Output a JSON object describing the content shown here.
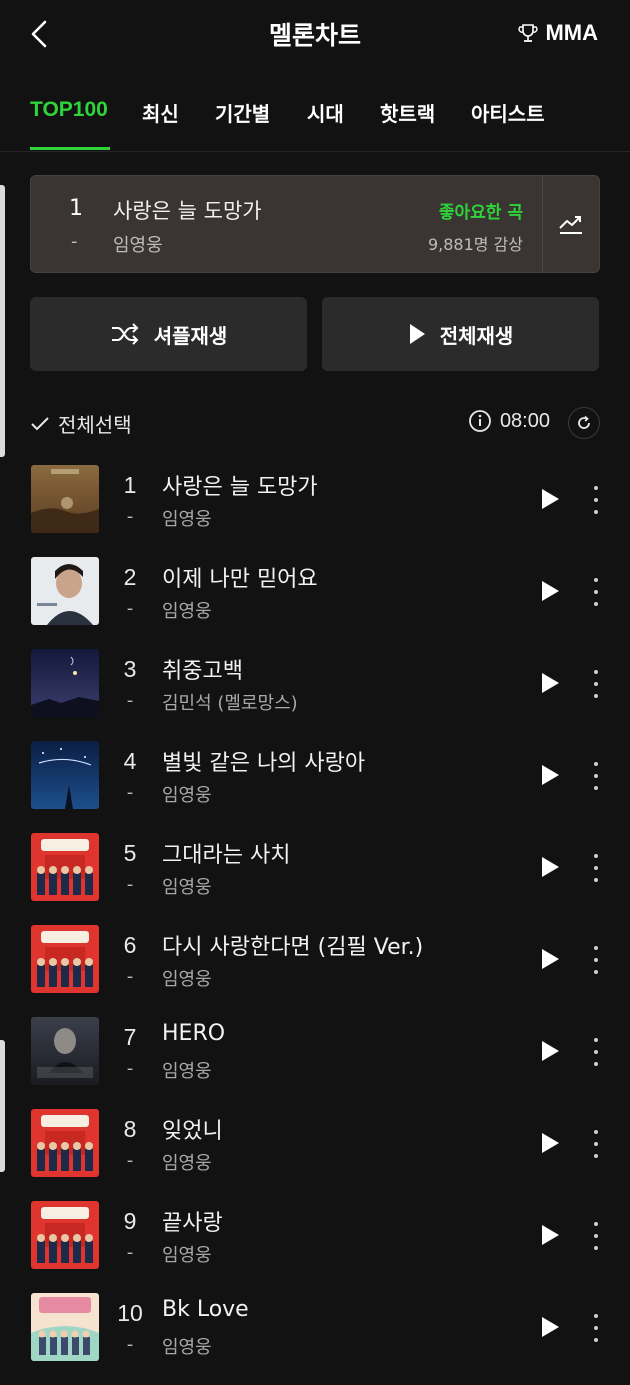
{
  "header": {
    "title": "멜론차트",
    "mma_label": "MMA"
  },
  "tabs": [
    {
      "label": "TOP100",
      "active": true
    },
    {
      "label": "최신"
    },
    {
      "label": "기간별"
    },
    {
      "label": "시대"
    },
    {
      "label": "핫트랙"
    },
    {
      "label": "아티스트"
    }
  ],
  "now_card": {
    "rank": "1",
    "change": "-",
    "title": "사랑은 늘 도망가",
    "artist": "임영웅",
    "like_label": "좋아요한 곡",
    "listeners": "9,881명 감상"
  },
  "actions": {
    "shuffle_label": "셔플재생",
    "play_all_label": "전체재생"
  },
  "list_header": {
    "select_all_label": "전체선택",
    "time": "08:00"
  },
  "colors": {
    "accent": "#2fd33a",
    "background": "#121212",
    "card": "#3a3533",
    "button": "#2b2b2b"
  },
  "songs": [
    {
      "rank": "1",
      "change": "-",
      "title": "사랑은 늘 도망가",
      "artist": "임영웅"
    },
    {
      "rank": "2",
      "change": "-",
      "title": "이제 나만 믿어요",
      "artist": "임영웅"
    },
    {
      "rank": "3",
      "change": "-",
      "title": "취중고백",
      "artist": "김민석 (멜로망스)"
    },
    {
      "rank": "4",
      "change": "-",
      "title": "별빛 같은 나의 사랑아",
      "artist": "임영웅"
    },
    {
      "rank": "5",
      "change": "-",
      "title": "그대라는 사치",
      "artist": "임영웅"
    },
    {
      "rank": "6",
      "change": "-",
      "title": "다시 사랑한다면 (김필 Ver.)",
      "artist": "임영웅"
    },
    {
      "rank": "7",
      "change": "-",
      "title": "HERO",
      "artist": "임영웅"
    },
    {
      "rank": "8",
      "change": "-",
      "title": "잊었니",
      "artist": "임영웅"
    },
    {
      "rank": "9",
      "change": "-",
      "title": "끝사랑",
      "artist": "임영웅"
    },
    {
      "rank": "10",
      "change": "-",
      "title": "Bk Love",
      "artist": "임영웅"
    }
  ]
}
